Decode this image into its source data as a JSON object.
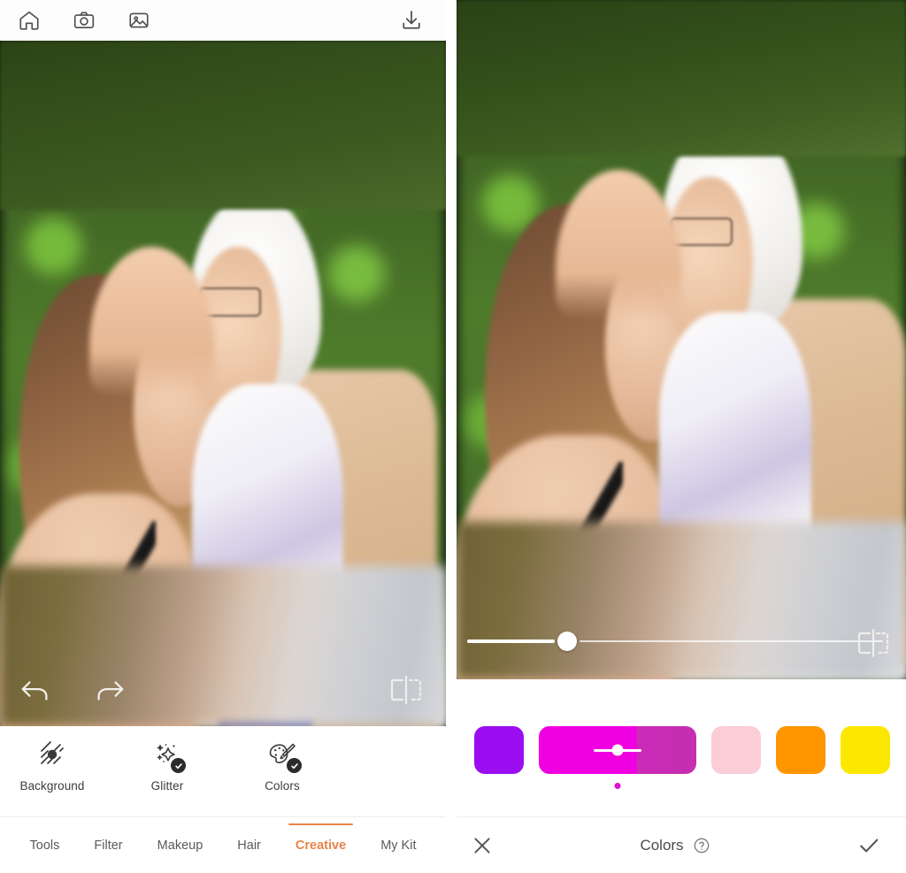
{
  "app": {
    "left_screen_name": "Creative editor — Colors applied",
    "right_screen_name": "Colors adjustment panel"
  },
  "left": {
    "top_bar": {
      "home_icon": "home-icon",
      "camera_icon": "camera-icon",
      "gallery_icon": "gallery-icon",
      "download_icon": "download-icon"
    },
    "canvas": {
      "photo_description": "Older woman with white hair and glasses kissing the forehead of a younger woman with long brown hair, green hedge background"
    },
    "overlay_controls": {
      "undo_icon": "undo-icon",
      "redo_icon": "redo-icon",
      "compare_icon": "compare-icon"
    },
    "tools": [
      {
        "label": "Background",
        "icon": "background-texture-icon",
        "applied": false
      },
      {
        "label": "Glitter",
        "icon": "glitter-sparkle-icon",
        "applied": true
      },
      {
        "label": "Colors",
        "icon": "color-palette-icon",
        "applied": true
      }
    ],
    "tabs": [
      {
        "label": "Tools",
        "active": false
      },
      {
        "label": "Filter",
        "active": false
      },
      {
        "label": "Makeup",
        "active": false
      },
      {
        "label": "Hair",
        "active": false
      },
      {
        "label": "Creative",
        "active": true
      },
      {
        "label": "My Kit",
        "active": false
      }
    ],
    "accent_color": "#e8844a"
  },
  "right": {
    "canvas": {
      "photo_description": "Zoomed crop of the same portrait — older woman kissing younger woman's forehead"
    },
    "slider": {
      "name": "intensity-slider",
      "value_percent": 21,
      "filled_color": "#ffffff",
      "track_color": "rgba(255,255,255,0.75)"
    },
    "compare_icon": "compare-icon",
    "swatches": [
      {
        "name": "swatch-purple",
        "color": "#9b0df0",
        "selected": false
      },
      {
        "name": "swatch-magenta",
        "color": "#f000e0",
        "color_secondary": "#cc2ab8",
        "selected": true
      },
      {
        "name": "swatch-pink",
        "color": "#fbcdd6",
        "selected": false
      },
      {
        "name": "swatch-orange",
        "color": "#ff9500",
        "selected": false
      },
      {
        "name": "swatch-yellow",
        "color": "#fce700",
        "selected": false
      }
    ],
    "selected_dot_color": "#e010cc",
    "action_bar": {
      "cancel_icon": "close-x-icon",
      "title": "Colors",
      "help_icon": "question-mark-icon",
      "confirm_icon": "checkmark-icon"
    }
  }
}
